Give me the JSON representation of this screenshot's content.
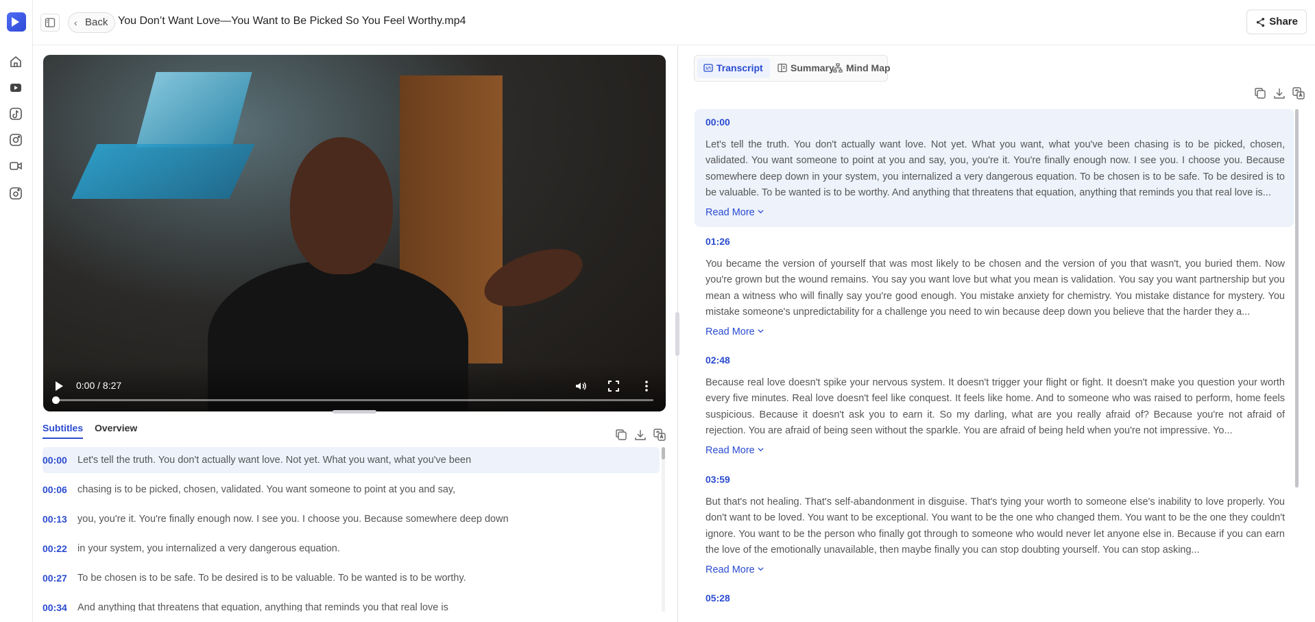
{
  "topbar": {
    "back_label": "Back",
    "file_title": "You Don’t Want Love—You Want to Be Picked So You Feel Worthy.mp4",
    "share_label": "Share"
  },
  "rail_icons": [
    "home-icon",
    "youtube-icon",
    "tiktok-icon",
    "instagram-icon",
    "video-camera-icon",
    "upload-icon"
  ],
  "video": {
    "time_display": "0:00 / 8:27",
    "progress": 0
  },
  "subtitles": {
    "tabs": [
      "Subtitles",
      "Overview"
    ],
    "active_tab": 0,
    "rows": [
      {
        "time": "00:00",
        "text": "Let's tell the truth. You don't actually want love. Not yet. What you want, what you've been"
      },
      {
        "time": "00:06",
        "text": "chasing is to be picked, chosen, validated. You want someone to point at you and say,"
      },
      {
        "time": "00:13",
        "text": "you, you're it. You're finally enough now. I see you. I choose you. Because somewhere deep down"
      },
      {
        "time": "00:22",
        "text": "in your system, you internalized a very dangerous equation."
      },
      {
        "time": "00:27",
        "text": "To be chosen is to be safe. To be desired is to be valuable. To be wanted is to be worthy."
      },
      {
        "time": "00:34",
        "text": "And anything that threatens that equation, anything that reminds you that real love is"
      }
    ]
  },
  "transcript": {
    "tabs": [
      "Transcript",
      "Summary",
      "Mind Map"
    ],
    "active_tab": 0,
    "read_more_label": "Read More",
    "blocks": [
      {
        "time": "00:00",
        "text": "Let's tell the truth. You don't actually want love. Not yet. What you want, what you've been chasing is to be picked, chosen, validated. You want someone to point at you and say, you, you're it. You're finally enough now. I see you. I choose you. Because somewhere deep down in your system, you internalized a very dangerous equation. To be chosen is to be safe. To be desired is to be valuable. To be wanted is to be worthy. And anything that threatens that equation, anything that reminds you that real love is..."
      },
      {
        "time": "01:26",
        "text": "You became the version of yourself that was most likely to be chosen and the version of you that wasn't, you buried them. Now you're grown but the wound remains. You say you want love but what you mean is validation. You say you want partnership but you mean a witness who will finally say you're good enough. You mistake anxiety for chemistry. You mistake distance for mystery. You mistake someone's unpredictability for a challenge you need to win because deep down you believe that the harder they a..."
      },
      {
        "time": "02:48",
        "text": "Because real love doesn't spike your nervous system. It doesn't trigger your flight or fight. It doesn't make you question your worth every five minutes. Real love doesn't feel like conquest. It feels like home. And to someone who was raised to perform, home feels suspicious. Because it doesn't ask you to earn it. So my darling, what are you really afraid of? Because you're not afraid of rejection. You are afraid of being seen without the sparkle. You are afraid of being held when you're not impressive. Yo..."
      },
      {
        "time": "03:59",
        "text": "But that's not healing. That's self-abandonment in disguise. That's tying your worth to someone else's inability to love properly. You don't want to be loved. You want to be exceptional. You want to be the one who changed them. You want to be the one they couldn't ignore. You want to be the person who finally got through to someone who would never let anyone else in. Because if you can earn the love of the emotionally unavailable, then maybe finally you can stop doubting yourself. You can stop asking..."
      },
      {
        "time": "05:28",
        "text": ""
      }
    ]
  }
}
